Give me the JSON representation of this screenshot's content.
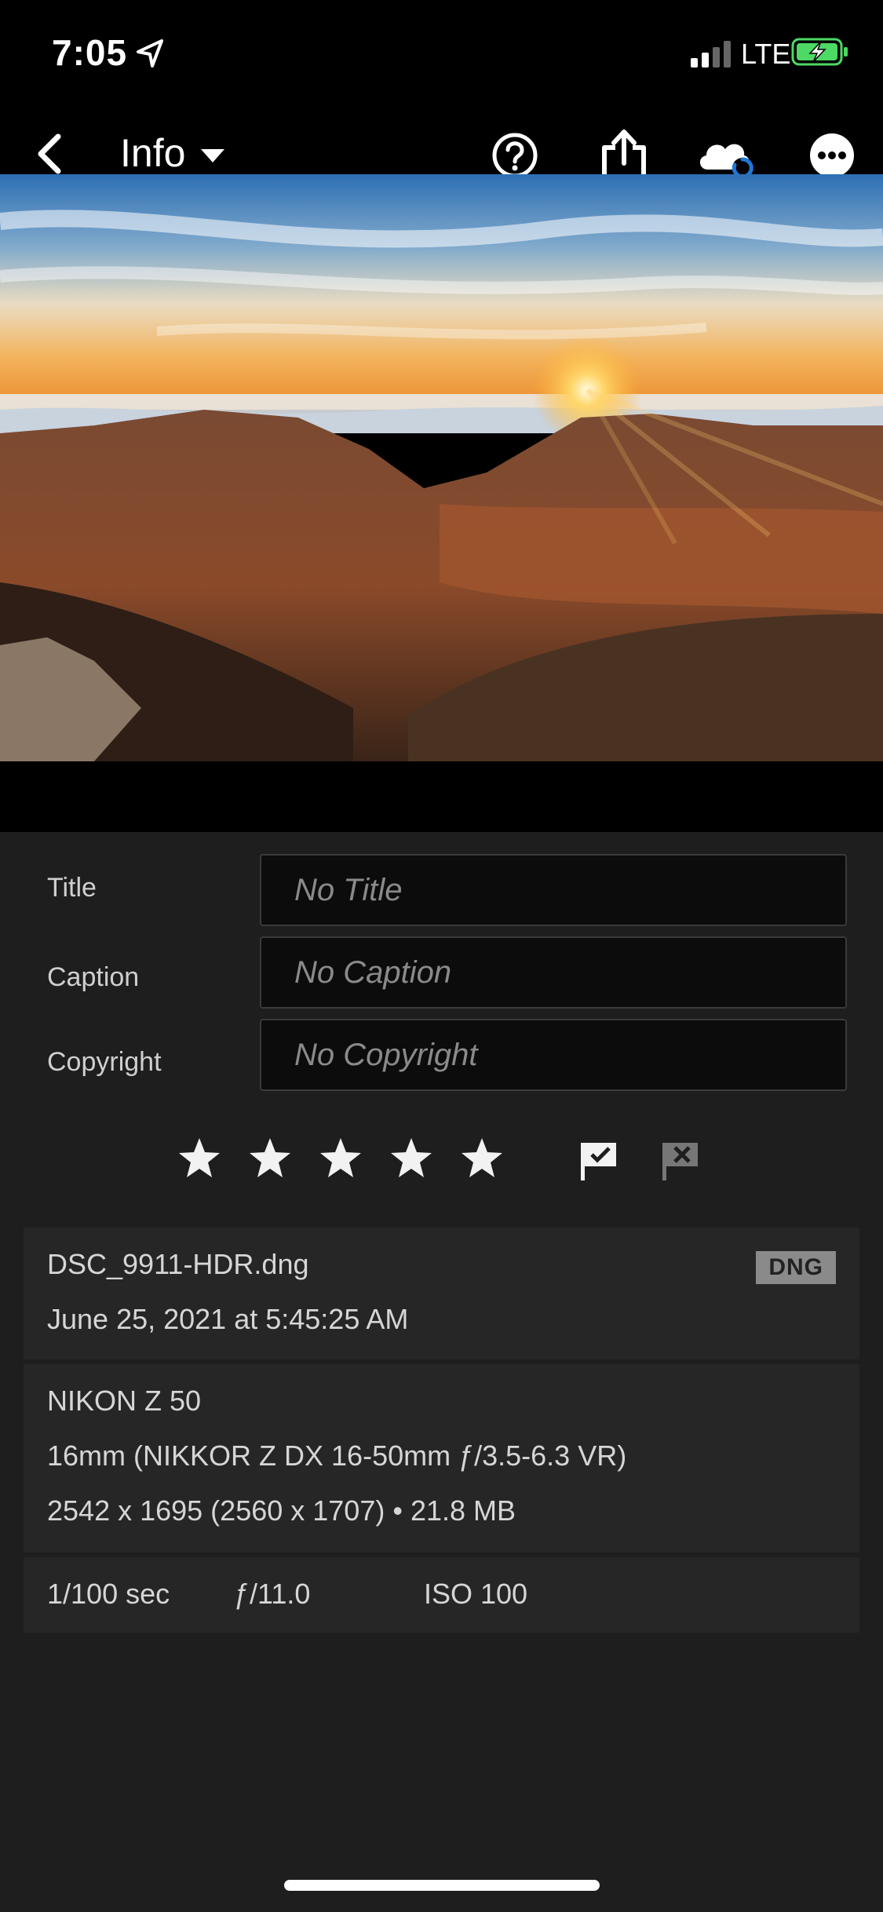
{
  "status": {
    "time": "7:05",
    "network": "LTE",
    "icons": [
      "location-arrow-icon",
      "signal-icon",
      "battery-charging-icon"
    ],
    "battery_color": "#4cd964"
  },
  "nav": {
    "title": "Info",
    "icons": [
      "back-chevron-icon",
      "caret-down-icon",
      "help-icon",
      "share-icon",
      "cloud-sync-icon",
      "more-icon"
    ]
  },
  "metadata": {
    "title_label": "Title",
    "title_placeholder": "No Title",
    "caption_label": "Caption",
    "caption_placeholder": "No Caption",
    "copyright_label": "Copyright",
    "copyright_placeholder": "No Copyright"
  },
  "rating": {
    "stars": 5,
    "flags": [
      "flag-pick-icon",
      "flag-reject-icon"
    ]
  },
  "file": {
    "name": "DSC_9911-HDR.dng",
    "date": "June 25, 2021 at 5:45:25 AM",
    "format": "DNG"
  },
  "camera": {
    "model": "NIKON Z 50",
    "lens": "16mm (NIKKOR Z DX 16-50mm ƒ/3.5-6.3 VR)",
    "dimensions": "2542 x 1695 (2560 x 1707) • 21.8 MB"
  },
  "exposure": {
    "shutter": "1/100 sec",
    "aperture": "ƒ/11.0",
    "iso": "ISO 100"
  }
}
